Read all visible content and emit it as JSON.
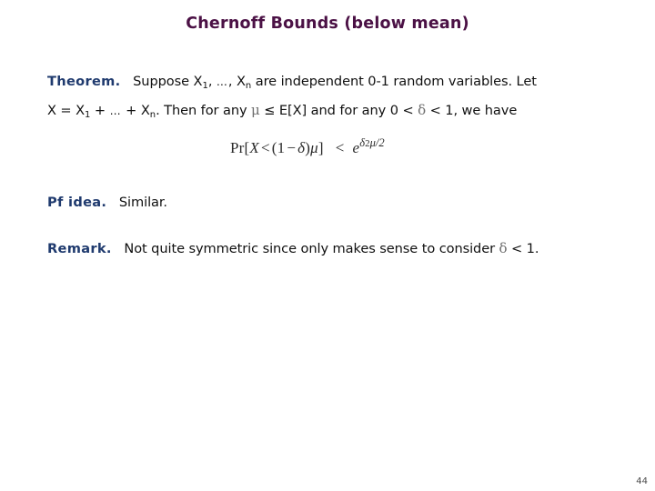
{
  "slide": {
    "title": "Chernoff Bounds (below mean)",
    "title_color": "#4b1145",
    "lead_color": "#1f3a6e",
    "body_color": "#101010",
    "background": "#ffffff",
    "page_number": "44"
  },
  "theorem": {
    "lead": "Theorem.",
    "line1_a": "Suppose X",
    "line1_sub1": "1",
    "line1_b": ", ",
    "line1_ellipsis": "…",
    "line1_c": ", X",
    "line1_sub2": "n",
    "line1_d": " are independent 0-1 random variables. Let",
    "line2_a": "X = X",
    "line2_sub1": "1",
    "line2_b": " + ",
    "line2_ellipsis": "…",
    "line2_c": " + X",
    "line2_sub2": "n",
    "line2_d": ". Then for any ",
    "line2_mu": "μ",
    "line2_e": " ≤ E[X] and for any 0 < ",
    "line2_delta": "δ",
    "line2_f": " < 1, we have"
  },
  "equation": {
    "pr": "Pr[",
    "var_x": "X",
    "lt1": "<",
    "open_paren": "(1",
    "minus": "−",
    "delta": "δ",
    "close_paren": ")",
    "mu": "μ",
    "bracket_close": "]",
    "lt2": "<",
    "e": "e",
    "exp_delta": "δ",
    "exp_power": "2",
    "exp_mu": "μ",
    "exp_div": "/2",
    "alt_text": "Pr[X < (1 − δ)μ] < e^(δ²μ/2)"
  },
  "pf_idea": {
    "lead": "Pf idea.",
    "text": "Similar."
  },
  "remark": {
    "lead": "Remark.",
    "text_a": "Not quite symmetric since only makes sense to consider ",
    "delta": "δ",
    "text_b": " < 1."
  }
}
